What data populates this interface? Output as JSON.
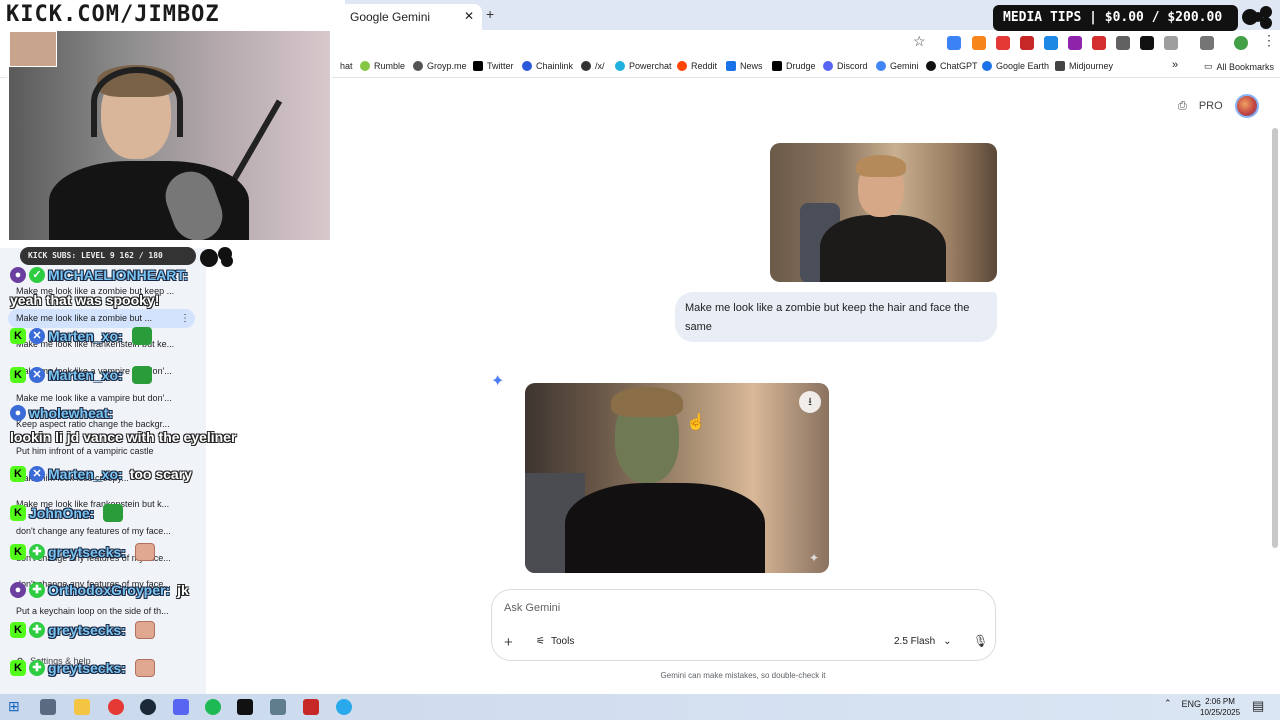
{
  "browser": {
    "active_tab_title": "Google Gemini",
    "bookmarks": [
      {
        "label": "hat",
        "color": "#5f6368"
      },
      {
        "label": "Rumble",
        "color": "#85c742"
      },
      {
        "label": "Groyp.me",
        "color": "#555555"
      },
      {
        "label": "Twitter",
        "color": "#000000"
      },
      {
        "label": "Chainlink",
        "color": "#2a5ada"
      },
      {
        "label": "/x/",
        "color": "#333333"
      },
      {
        "label": "Powerchat",
        "color": "#20b0e0"
      },
      {
        "label": "Reddit",
        "color": "#ff4500"
      },
      {
        "label": "News",
        "color": "#1a73e8"
      },
      {
        "label": "Drudge",
        "color": "#000000"
      },
      {
        "label": "Discord",
        "color": "#5865f2"
      },
      {
        "label": "Gemini",
        "color": "#4285f4"
      },
      {
        "label": "ChatGPT",
        "color": "#111111"
      },
      {
        "label": "Google Earth",
        "color": "#1a73e8"
      },
      {
        "label": "Midjourney",
        "color": "#444444"
      }
    ],
    "all_bookmarks": "All Bookmarks"
  },
  "gemini": {
    "pro_label": "PRO",
    "user_prompt": "Make me look like a zombie but keep the hair and face the same",
    "input_placeholder": "Ask Gemini",
    "tools_label": "Tools",
    "model_label": "2.5 Flash",
    "disclaimer": "Gemini can make mistakes, so double-check it"
  },
  "overlay": {
    "url_banner": "KICK.COM/JIMBOZ",
    "tips_banner": "MEDIA TIPS | $0.00 / $200.00",
    "subs_badge": "KICK SUBS: LEVEL 9 162 / 180"
  },
  "sidebar": {
    "history": [
      "Make me look like a zombie but keep ...",
      "Make me look like a zombie but ...",
      "Make me look like frankenstein but ke...",
      "Make me look like a vampire but don'...",
      "Make me look like a vampire but don'...",
      "Keep aspect ratio change the backgr...",
      "Put him infront of a vampiric castle",
      "Make him look less creepy...",
      "Make me look like frankenstein but k...",
      "don't change any features of my face...",
      "don't change any features of my face...",
      "don't change any features of my face...",
      "Put a keychain loop on the side of th..."
    ],
    "settings_label": "Settings & help"
  },
  "chat": [
    {
      "user": "MICHAELIONHEART:",
      "message": "yeah that was spooky!"
    },
    {
      "user": "Marten_xo:",
      "message": ""
    },
    {
      "user": "Marten_xo:",
      "message": ""
    },
    {
      "user": "wholewheat:",
      "message": "lookin li jd vance with the eyeliner"
    },
    {
      "user": "Marten_xo:",
      "message": "too scary"
    },
    {
      "user": "JohnOne:",
      "message": ""
    },
    {
      "user": "greytsecks:",
      "message": ""
    },
    {
      "user": "OrthodoxGroyper:",
      "message": "jk"
    },
    {
      "user": "greytsecks:",
      "message": ""
    },
    {
      "user": "greytsecks:",
      "message": ""
    }
  ],
  "taskbar": {
    "lang": "ENG",
    "time": "2:06 PM",
    "date": "10/25/2025"
  }
}
